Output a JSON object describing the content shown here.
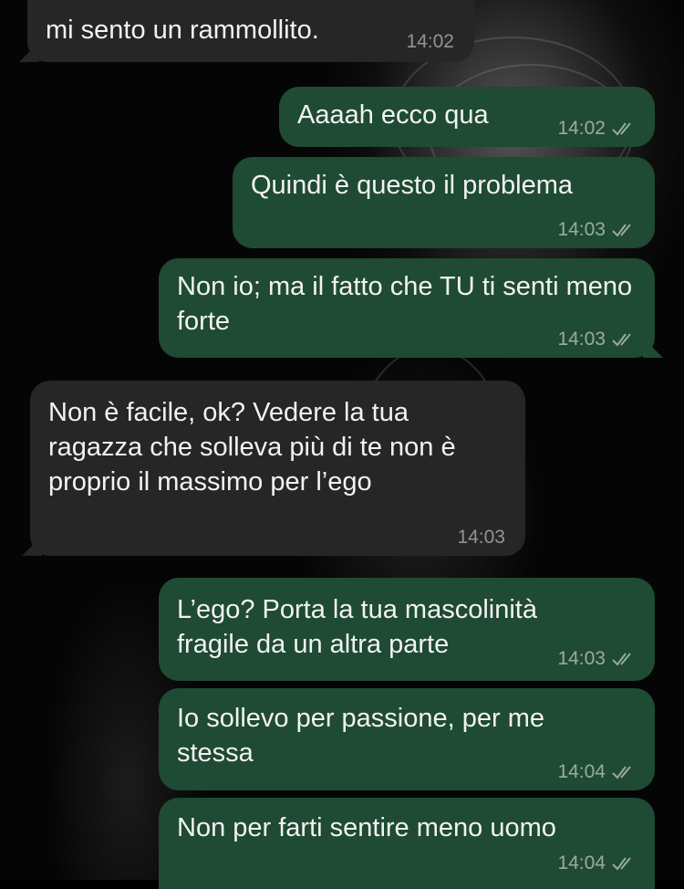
{
  "chat": {
    "messages": [
      {
        "direction": "incoming",
        "text": "mi sento un rammollito.",
        "time": "14:02",
        "read_icon": "double-check-icon"
      },
      {
        "direction": "outgoing",
        "text": "Aaaah ecco qua",
        "time": "14:02",
        "read_icon": "double-check-icon"
      },
      {
        "direction": "outgoing",
        "text": "Quindi è questo il problema",
        "time": "14:03",
        "read_icon": "double-check-icon"
      },
      {
        "direction": "outgoing",
        "text": "Non io; ma il fatto che TU ti senti meno forte",
        "time": "14:03",
        "read_icon": "double-check-icon"
      },
      {
        "direction": "incoming",
        "text": "Non è facile, ok? Vedere la tua ragazza che solleva più di te non è proprio il massimo per l’ego",
        "time": "14:03",
        "read_icon": ""
      },
      {
        "direction": "outgoing",
        "text": "L’ego? Porta la tua mascolinità fragile da un altra parte",
        "time": "14:03",
        "read_icon": "double-check-icon"
      },
      {
        "direction": "outgoing",
        "text": "Io sollevo per passione, per me stessa",
        "time": "14:04",
        "read_icon": "double-check-icon"
      },
      {
        "direction": "outgoing",
        "text": "Non per farti sentire meno uomo",
        "time": "14:04",
        "read_icon": "double-check-icon"
      }
    ]
  },
  "colors": {
    "background": "#000000",
    "incoming_bubble": "#262626",
    "outgoing_bubble": "#1f4a33",
    "text": "#f2f2f2",
    "meta_text": "#9a9a9a"
  }
}
